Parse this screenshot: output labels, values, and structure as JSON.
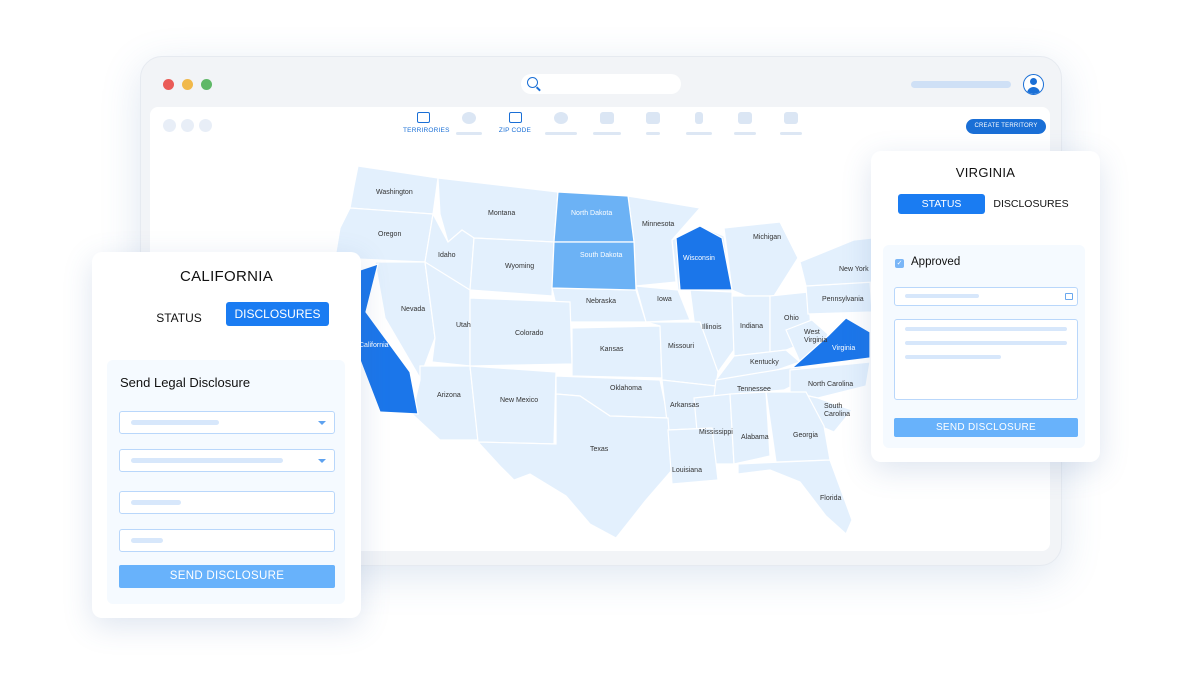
{
  "toolbar": {
    "nav": [
      {
        "icon": "map-icon",
        "label": "TERRIRORIES",
        "active": true
      },
      {
        "icon": "car-icon",
        "label": "",
        "active": false
      },
      {
        "icon": "map-pin-icon",
        "label": "ZIP CODE",
        "active": true
      },
      {
        "icon": "globe-icon",
        "label": "",
        "active": false
      },
      {
        "icon": "users-icon",
        "label": "",
        "active": false
      },
      {
        "icon": "briefcase-icon",
        "label": "",
        "active": false
      },
      {
        "icon": "dollar-icon",
        "label": "",
        "active": false
      },
      {
        "icon": "home-icon",
        "label": "",
        "active": false
      },
      {
        "icon": "menu-icon",
        "label": "",
        "active": false
      }
    ],
    "create_button": "CREATE TERRITORY"
  },
  "map": {
    "states": [
      "Washington",
      "Oregon",
      "Montana",
      "Idaho",
      "Wyoming",
      "North Dakota",
      "South Dakota",
      "Minnesota",
      "Wisconsin",
      "Michigan",
      "Nebraska",
      "Iowa",
      "Illinois",
      "Indiana",
      "Ohio",
      "Pennsylvania",
      "New York",
      "Nevada",
      "Utah",
      "Colorado",
      "Kansas",
      "Missouri",
      "Kentucky",
      "West Virginia",
      "Virginia",
      "California",
      "Arizona",
      "New Mexico",
      "Oklahoma",
      "Arkansas",
      "Tennessee",
      "North Carolina",
      "South Carolina",
      "Mississippi",
      "Alabama",
      "Georgia",
      "Texas",
      "Louisiana",
      "Florida"
    ],
    "highlighted_dark": [
      "California",
      "Wisconsin",
      "Virginia"
    ],
    "highlighted_light": [
      "North Dakota",
      "South Dakota"
    ],
    "colors": {
      "base": "#e3f0fd",
      "light": "#6cb2f5",
      "dark": "#1b76ea"
    }
  },
  "california_card": {
    "title": "CALIFORNIA",
    "tab_status": "STATUS",
    "tab_disclosures": "DISCLOSURES",
    "active_tab": "DISCLOSURES",
    "section_title": "Send Legal Disclosure",
    "send_button": "SEND DISCLOSURE"
  },
  "virginia_card": {
    "title": "VIRGINIA",
    "tab_status": "STATUS",
    "tab_disclosures": "DISCLOSURES",
    "active_tab": "STATUS",
    "approved_label": "Approved",
    "approved_checked": true,
    "send_button": "SEND DISCLOSURE"
  }
}
